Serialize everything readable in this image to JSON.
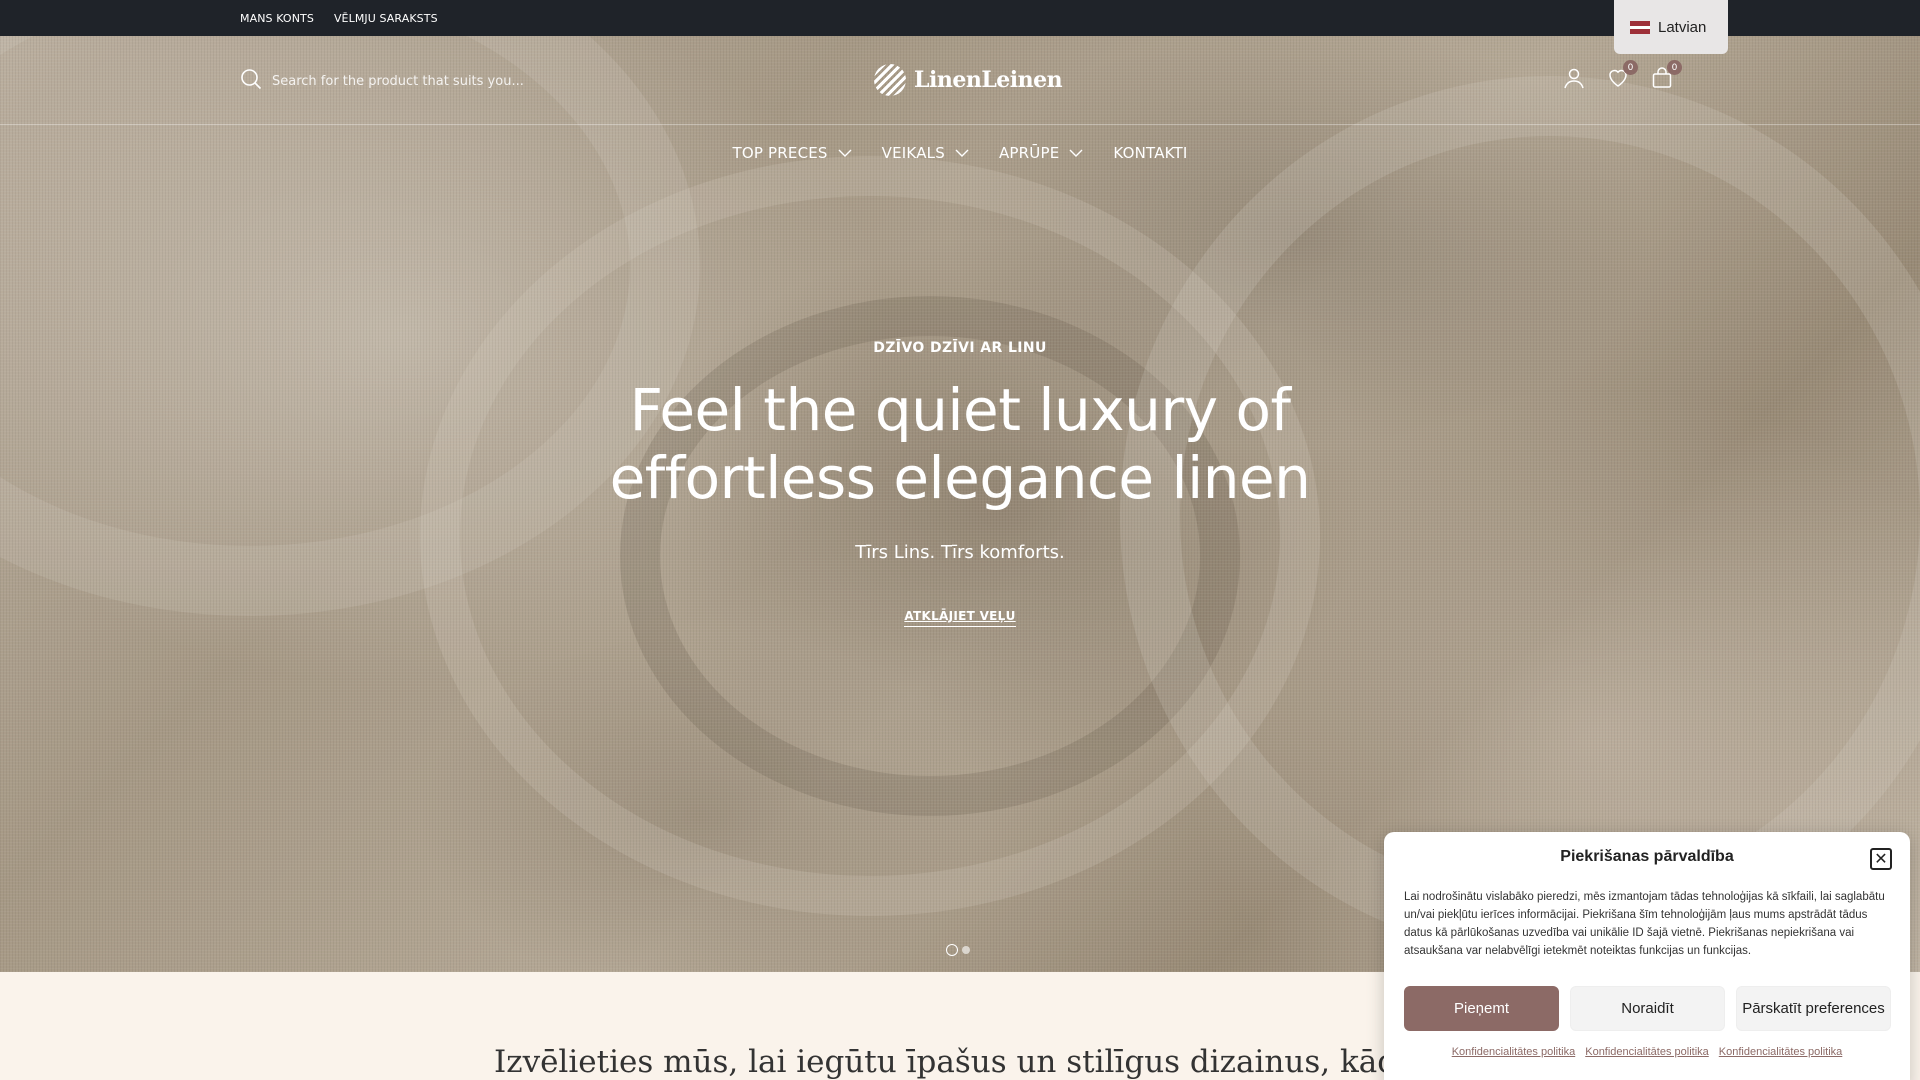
{
  "topbar": {
    "links": [
      "MANS KONTS",
      "VĒLMJU SARAKSTS"
    ],
    "language": "Latvian"
  },
  "header": {
    "search_placeholder": "Search for the product that suits you...",
    "logo_text": "LinenLeinen",
    "wishlist_count": "0",
    "cart_count": "0"
  },
  "nav": {
    "items": [
      "TOP PRECES",
      "VEIKALS",
      "APRŪPE",
      "KONTAKTI"
    ]
  },
  "hero": {
    "eyebrow": "DZĪVO DZĪVI AR LINU",
    "headline_line1": "Feel the quiet luxury of",
    "headline_line2": "effortless elegance linen",
    "subtitle": "Tīrs Lins. Tīrs komforts.",
    "cta": "ATKLĀJIET VEĻU"
  },
  "bottom": {
    "heading": "Izvēlieties mūs, lai iegūtu īpašus un stilīgus dizainus, kādus vēl nekad neesat redzējuši"
  },
  "cookie": {
    "title": "Piekrišanas pārvaldība",
    "body": "Lai nodrošinātu vislabāko pieredzi, mēs izmantojam tādas tehnoloģijas kā sīkfaili, lai saglabātu un/vai piekļūtu ierīces informācijai. Piekrišana šīm tehnoloģijām ļaus mums apstrādāt tādus datus kā pārlūkošanas uzvedība vai unikālie ID šajā vietnē. Piekrišanas nepiekrišana vai atsaukšana var nelabvēlīgi ietekmēt noteiktas funkcijas un funkcijas.",
    "accept": "Pieņemt",
    "deny": "Noraidīt",
    "preferences": "Pārskatīt preferences",
    "policy_links": [
      "Konfidencialitātes politika",
      "Konfidencialitātes politika",
      "Konfidencialitātes politika"
    ]
  },
  "colors": {
    "topbar": "#1f2329",
    "accent": "#8c6a66",
    "section_bg": "#faf3eb"
  }
}
